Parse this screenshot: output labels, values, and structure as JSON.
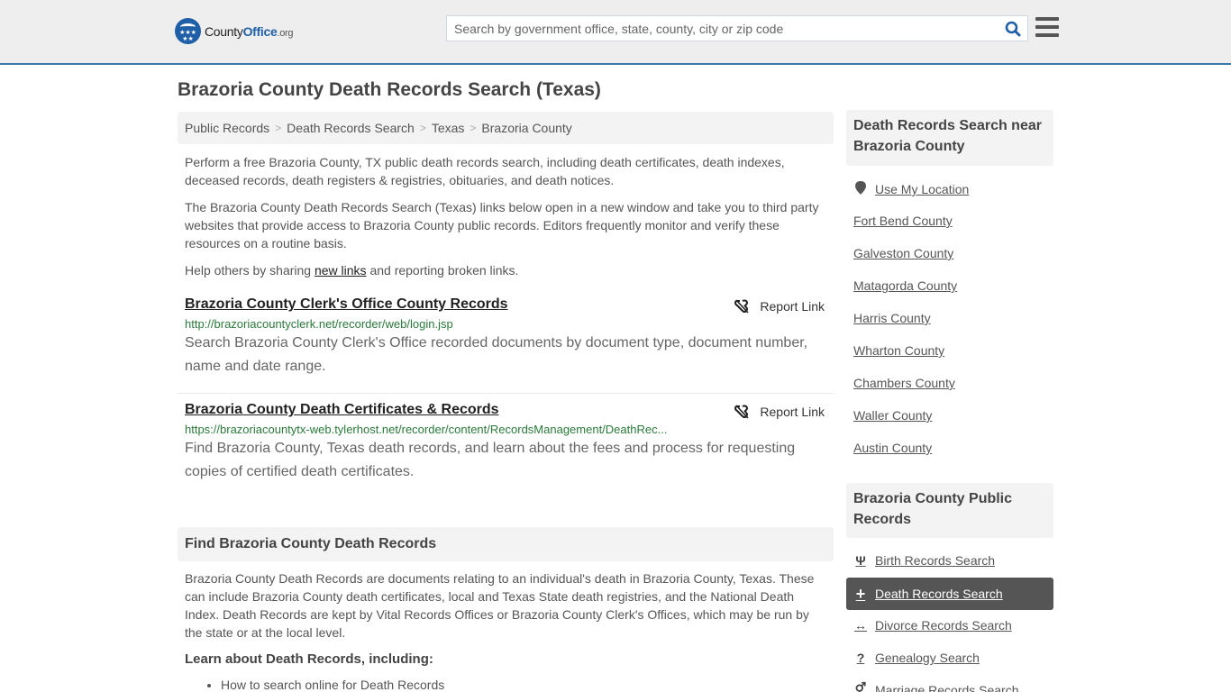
{
  "header": {
    "logo": {
      "county": "County",
      "office": "Office",
      "tld": ".org"
    },
    "search_placeholder": "Search by government office, state, county, city or zip code",
    "search_icon": "search-icon",
    "menu_icon": "hamburger-menu-icon"
  },
  "page_title": "Brazoria County Death Records Search (Texas)",
  "breadcrumb": [
    "Public Records",
    "Death Records Search",
    "Texas",
    "Brazoria County"
  ],
  "intro": {
    "p1": "Perform a free Brazoria County, TX public death records search, including death certificates, death indexes, deceased records, death registers & registries, obituaries, and death notices.",
    "p2": "The Brazoria County Death Records Search (Texas) links below open in a new window and take you to third party websites that provide access to Brazoria County public records. Editors frequently monitor and verify these resources on a routine basis.",
    "p3_before": "Help others by sharing ",
    "p3_link": "new links",
    "p3_after": " and reporting broken links."
  },
  "results": [
    {
      "title": "Brazoria County Clerk's Office County Records",
      "url": "http://brazoriacountyclerk.net/recorder/web/login.jsp",
      "description": "Search Brazoria County Clerk's Office recorded documents by document type, document number, name and date range.",
      "report_label": "Report Link"
    },
    {
      "title": "Brazoria County Death Certificates & Records",
      "url": "https://brazoriacountytx-web.tylerhost.net/recorder/content/RecordsManagement/DeathRec...",
      "description": "Find Brazoria County, Texas death records, and learn about the fees and process for requesting copies of certified death certificates.",
      "report_label": "Report Link"
    }
  ],
  "find_section": {
    "heading": "Find Brazoria County Death Records",
    "body": "Brazoria County Death Records are documents relating to an individual's death in Brazoria County, Texas. These can include Brazoria County death certificates, local and Texas State death registries, and the National Death Index. Death Records are kept by Vital Records Offices or Brazoria County Clerk's Offices, which may be run by the state or at the local level.",
    "learn_heading": "Learn about Death Records, including:",
    "learn_items": [
      "How to search online for Death Records"
    ]
  },
  "sidebar": {
    "nearby_heading": "Death Records Search near Brazoria County",
    "use_location": "Use My Location",
    "nearby": [
      "Fort Bend County",
      "Galveston County",
      "Matagorda County",
      "Harris County",
      "Wharton County",
      "Chambers County",
      "Waller County",
      "Austin County"
    ],
    "public_heading": "Brazoria County Public Records",
    "public_links": [
      {
        "label": "Birth Records Search",
        "icon": "child-icon",
        "glyph": "Ψ",
        "active": false
      },
      {
        "label": "Death Records Search",
        "icon": "plus-icon",
        "glyph": "+",
        "active": true
      },
      {
        "label": "Divorce Records Search",
        "icon": "arrows-horizontal-icon",
        "glyph": "↔",
        "active": false
      },
      {
        "label": "Genealogy Search",
        "icon": "question-icon",
        "glyph": "?",
        "active": false
      },
      {
        "label": "Marriage Records Search",
        "icon": "venus-mars-icon",
        "glyph": "⚥",
        "active": false
      }
    ]
  },
  "colors": {
    "header_bg": "#eeeeee",
    "header_border": "#3a7aab",
    "brand_blue": "#1f5fa8",
    "url_green": "#2a7a3a",
    "active_bg": "#555555"
  }
}
